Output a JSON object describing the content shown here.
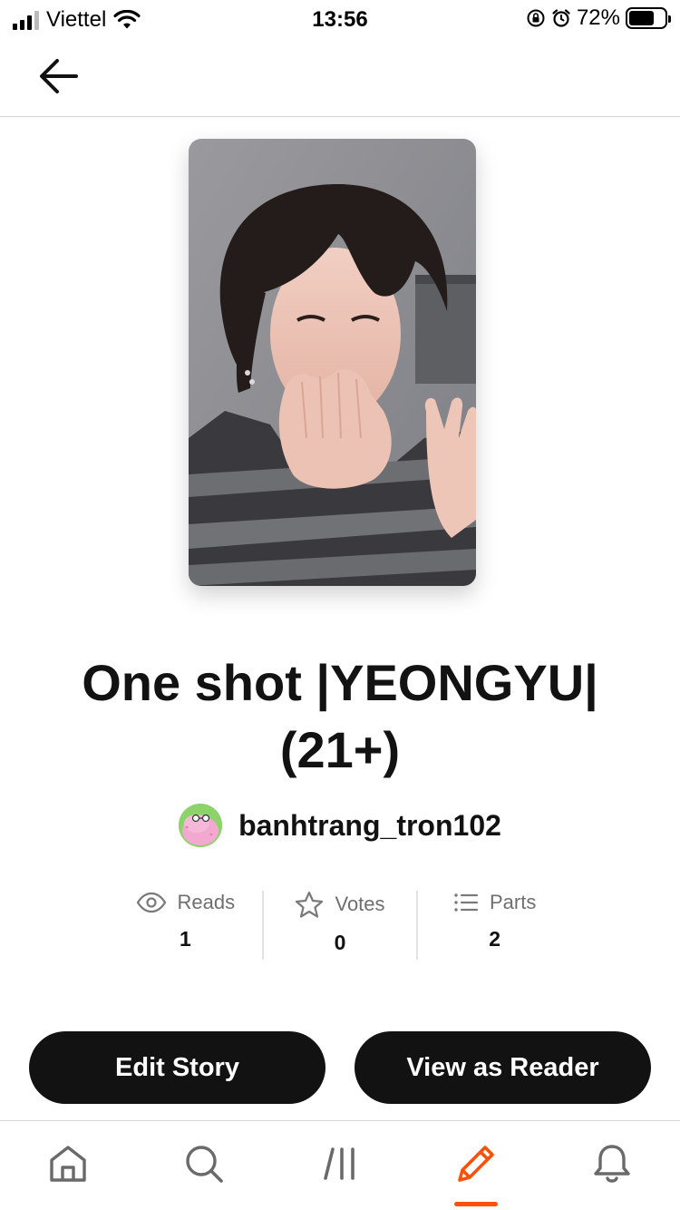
{
  "status_bar": {
    "carrier": "Viettel",
    "time": "13:56",
    "battery_percent": "72%",
    "battery_level": 0.72
  },
  "story": {
    "title": "One shot |YEONGYU| (21+)",
    "author": "banhtrang_tron102"
  },
  "stats": [
    {
      "label": "Reads",
      "value": "1",
      "icon": "eye-icon"
    },
    {
      "label": "Votes",
      "value": "0",
      "icon": "star-icon"
    },
    {
      "label": "Parts",
      "value": "2",
      "icon": "list-icon"
    }
  ],
  "actions": {
    "edit_label": "Edit Story",
    "reader_label": "View as Reader"
  },
  "tabbar": {
    "items": [
      "home-icon",
      "search-icon",
      "library-icon",
      "write-icon",
      "notifications-icon"
    ],
    "active": "write-icon"
  },
  "colors": {
    "accent": "#ff500a",
    "button_bg": "#121212",
    "text_muted": "#6f6f6f"
  }
}
